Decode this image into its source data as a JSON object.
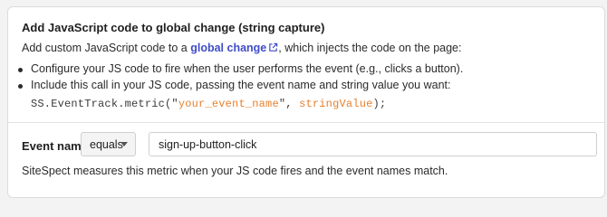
{
  "section": {
    "title": "Add JavaScript code to global change (string capture)"
  },
  "intro": {
    "prefix": "Add custom JavaScript code to a ",
    "link_label": "global change",
    "link_icon": "external-link-icon",
    "suffix": ", which injects the code on the page:"
  },
  "bullets": [
    {
      "text": "Configure your JS code to fire when the user performs the event (e.g., clicks a button)."
    },
    {
      "text": "Include this call in your JS code, passing the event name and string value you want:"
    }
  ],
  "code": {
    "prefix": "SS.EventTrack.metric(\"",
    "arg1": "your_event_name",
    "middle": "\", ",
    "arg2": "stringValue",
    "suffix": ");"
  },
  "event_field": {
    "label": "Event name",
    "operator": "equals",
    "value": "sign-up-button-click"
  },
  "note": "SiteSpect measures this metric when your JS code fires and the event names match.",
  "colors": {
    "link": "#3f4cc9",
    "code_argument": "#e6812f",
    "background": "#f3f3f3"
  }
}
